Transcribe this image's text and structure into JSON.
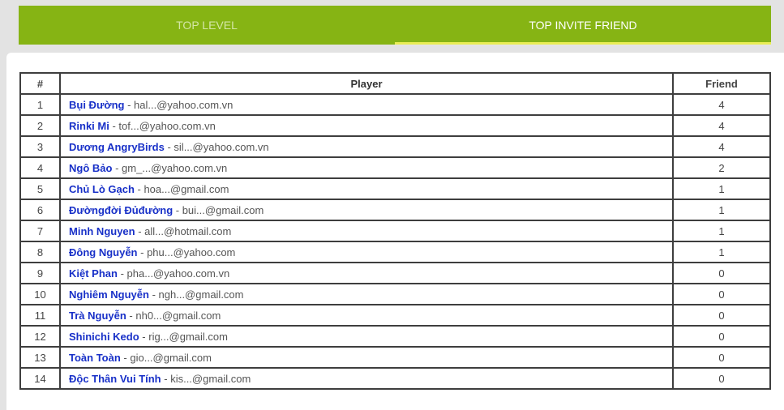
{
  "tabs": [
    {
      "label": "TOP LEVEL",
      "active": false
    },
    {
      "label": "TOP INVITE FRIEND",
      "active": true
    }
  ],
  "table": {
    "headers": {
      "index": "#",
      "player": "Player",
      "friend": "Friend"
    },
    "rows": [
      {
        "index": "1",
        "name": "Bụi Đường",
        "email": "hal...@yahoo.com.vn",
        "friends": "4"
      },
      {
        "index": "2",
        "name": "Rinki Mi",
        "email": "tof...@yahoo.com.vn",
        "friends": "4"
      },
      {
        "index": "3",
        "name": "Dương AngryBirds",
        "email": "sil...@yahoo.com.vn",
        "friends": "4"
      },
      {
        "index": "4",
        "name": "Ngô Bảo",
        "email": "gm_...@yahoo.com.vn",
        "friends": "2"
      },
      {
        "index": "5",
        "name": "Chủ Lò Gạch",
        "email": "hoa...@gmail.com",
        "friends": "1"
      },
      {
        "index": "6",
        "name": "Đườngđời Đủđường",
        "email": "bui...@gmail.com",
        "friends": "1"
      },
      {
        "index": "7",
        "name": "Minh Nguyen",
        "email": "all...@hotmail.com",
        "friends": "1"
      },
      {
        "index": "8",
        "name": "Đông Nguyễn",
        "email": "phu...@yahoo.com",
        "friends": "1"
      },
      {
        "index": "9",
        "name": "Kiệt Phan",
        "email": "pha...@yahoo.com.vn",
        "friends": "0"
      },
      {
        "index": "10",
        "name": "Nghiêm Nguyễn",
        "email": "ngh...@gmail.com",
        "friends": "0"
      },
      {
        "index": "11",
        "name": "Trà Nguyễn",
        "email": "nh0...@gmail.com",
        "friends": "0"
      },
      {
        "index": "12",
        "name": "Shinichi Kedo",
        "email": "rig...@gmail.com",
        "friends": "0"
      },
      {
        "index": "13",
        "name": "Toàn Toàn",
        "email": "gio...@gmail.com",
        "friends": "0"
      },
      {
        "index": "14",
        "name": "Độc Thân Vui Tính",
        "email": "kis...@gmail.com",
        "friends": "0"
      }
    ]
  }
}
